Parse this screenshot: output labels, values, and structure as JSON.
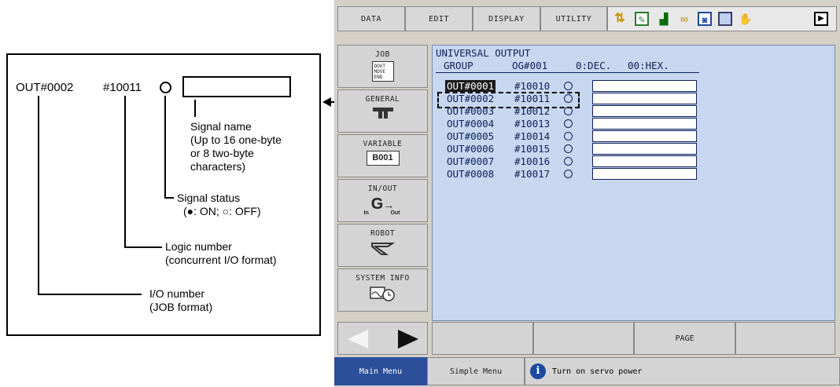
{
  "annotation": {
    "sample_io": "OUT#0002",
    "sample_logic": "#10011",
    "signal_name": [
      "Signal name",
      "(Up to 16 one-byte",
      "or 8 two-byte",
      "characters)"
    ],
    "signal_status_title": "Signal status",
    "signal_status_detail": "(●: ON; ○: OFF)",
    "logic_number": [
      "Logic number",
      "(concurrent I/O format)"
    ],
    "io_number": [
      "I/O number",
      "(JOB format)"
    ]
  },
  "menu": {
    "data": "DATA",
    "edit": "EDIT",
    "display": "DISPLAY",
    "utility": "UTILITY"
  },
  "sidebar": [
    {
      "label": "JOB",
      "icon": "job-icon"
    },
    {
      "label": "GENERAL",
      "icon": "general-icon"
    },
    {
      "label": "VARIABLE",
      "icon": "variable-icon",
      "tag": "B001"
    },
    {
      "label": "IN/OUT",
      "icon": "in-out-icon",
      "sub_in": "In",
      "sub_out": "Out"
    },
    {
      "label": "ROBOT",
      "icon": "robot-icon"
    },
    {
      "label": "SYSTEM INFO",
      "icon": "system-info-icon"
    }
  ],
  "job_icon_lines": [
    "DOUT",
    "MOVE",
    "END"
  ],
  "screen": {
    "title": "UNIVERSAL OUTPUT",
    "group_label": "GROUP",
    "group_value": "OG#001",
    "dec": "0:DEC.",
    "hex": "00:HEX.",
    "rows": [
      {
        "io": "OUT#0001",
        "logic": "#10010",
        "status": "off",
        "name": ""
      },
      {
        "io": "OUT#0002",
        "logic": "#10011",
        "status": "off",
        "name": ""
      },
      {
        "io": "OUT#0003",
        "logic": "#10012",
        "status": "off",
        "name": ""
      },
      {
        "io": "OUT#0004",
        "logic": "#10013",
        "status": "off",
        "name": ""
      },
      {
        "io": "OUT#0005",
        "logic": "#10014",
        "status": "off",
        "name": ""
      },
      {
        "io": "OUT#0006",
        "logic": "#10015",
        "status": "off",
        "name": ""
      },
      {
        "io": "OUT#0007",
        "logic": "#10016",
        "status": "off",
        "name": ""
      },
      {
        "io": "OUT#0008",
        "logic": "#10017",
        "status": "off",
        "name": ""
      }
    ]
  },
  "function_bar": {
    "page": "PAGE"
  },
  "status_bar": {
    "main_menu": "Main Menu",
    "simple_menu": "Simple Menu",
    "message": "Turn on servo power"
  },
  "colors": {
    "screen_bg": "#c6d7ef",
    "main_menu_bg": "#2c4f9a",
    "selected_row_bg": "#1a1a1a"
  }
}
